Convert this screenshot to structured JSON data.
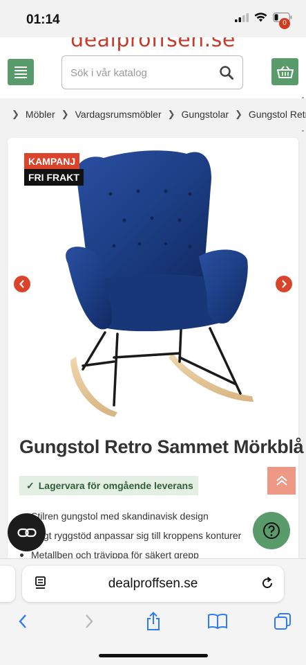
{
  "status_bar": {
    "time": "01:14"
  },
  "header": {
    "logo_text": "dealproffsen.se",
    "search_placeholder": "Sök i vår katalog",
    "cart_count": "0"
  },
  "breadcrumb": [
    "Möbler",
    "Vardagsrumsmöbler",
    "Gungstolar",
    "Gungstol Retro"
  ],
  "product": {
    "badge_campaign": "KAMPANJ",
    "badge_shipping": "FRI FRAKT",
    "title": "Gungstol Retro Sammet Mörkblå",
    "stock_text": "Lagervara för omgående leverans",
    "bullets": [
      "Stilren gungstol med skandinavisk design",
      "Högt ryggstöd anpassar sig till kroppens konturer",
      "Metallben och trävippa för säkert grepp"
    ]
  },
  "browser": {
    "url": "dealproffsen.se"
  },
  "colors": {
    "brand_green": "#5a9b6b",
    "accent_red": "#d9442b",
    "chair_blue": "#1d3f86"
  }
}
